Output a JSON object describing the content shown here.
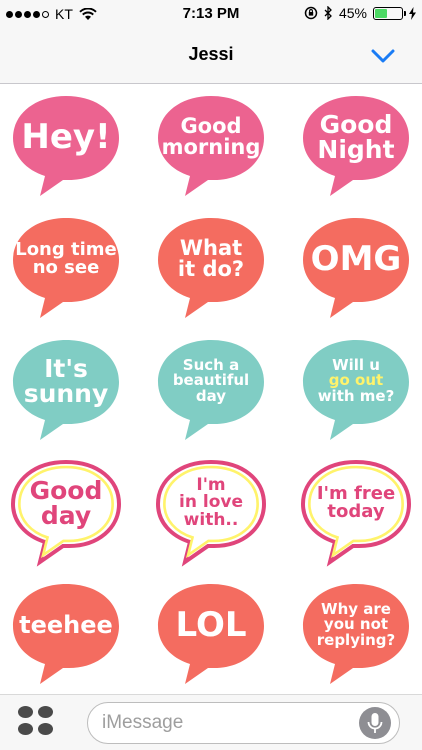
{
  "status_bar": {
    "carrier": "KT",
    "time": "7:13 PM",
    "battery_percent": "45%",
    "battery_level": 0.45,
    "icons": [
      "signal-dots-icon",
      "wifi-icon",
      "orientation-lock-icon",
      "bluetooth-icon",
      "battery-icon",
      "charging-bolt-icon"
    ]
  },
  "nav": {
    "title": "Jessi",
    "chevron_icon": "chevron-down-icon",
    "accent": "#1a7cf5"
  },
  "colors": {
    "pink": "#ec6390",
    "coral": "#f46c60",
    "teal": "#80cdc4",
    "outline_pink": "#e0457b",
    "outline_yellow": "#fff36b",
    "white": "#ffffff"
  },
  "stickers": [
    {
      "name": "hey",
      "lines": [
        "Hey!"
      ],
      "style": "pink"
    },
    {
      "name": "good-morning",
      "lines": [
        "Good",
        "morning"
      ],
      "style": "pink"
    },
    {
      "name": "good-night",
      "lines": [
        "Good",
        "Night"
      ],
      "style": "pink"
    },
    {
      "name": "long-time-no-see",
      "lines": [
        "Long time",
        "no see"
      ],
      "style": "coral"
    },
    {
      "name": "what-it-do",
      "lines": [
        "What",
        "it do?"
      ],
      "style": "coral"
    },
    {
      "name": "omg",
      "lines": [
        "OMG"
      ],
      "style": "coral"
    },
    {
      "name": "its-sunny",
      "lines": [
        "It's",
        "sunny"
      ],
      "style": "teal"
    },
    {
      "name": "such-a-beautiful-day",
      "lines": [
        "Such a",
        "beautiful",
        "day"
      ],
      "style": "teal"
    },
    {
      "name": "will-u-go-out-with-me",
      "lines": [
        "Will u",
        "go out",
        "with me?"
      ],
      "style": "teal"
    },
    {
      "name": "good-day",
      "lines": [
        "Good",
        "day"
      ],
      "style": "outline"
    },
    {
      "name": "im-in-love-with",
      "lines": [
        "I'm",
        "in love",
        "with.."
      ],
      "style": "outline"
    },
    {
      "name": "im-free-today",
      "lines": [
        "I'm free",
        "today"
      ],
      "style": "outline"
    },
    {
      "name": "teehee",
      "lines": [
        "teehee"
      ],
      "style": "coral"
    },
    {
      "name": "lol",
      "lines": [
        "LOL"
      ],
      "style": "coral"
    },
    {
      "name": "why-are-you-not-replying",
      "lines": [
        "Why are",
        "you not",
        "replying?"
      ],
      "style": "coral"
    }
  ],
  "compose": {
    "placeholder": "iMessage",
    "apps_icon": "app-drawer-icon",
    "mic_icon": "microphone-icon"
  }
}
